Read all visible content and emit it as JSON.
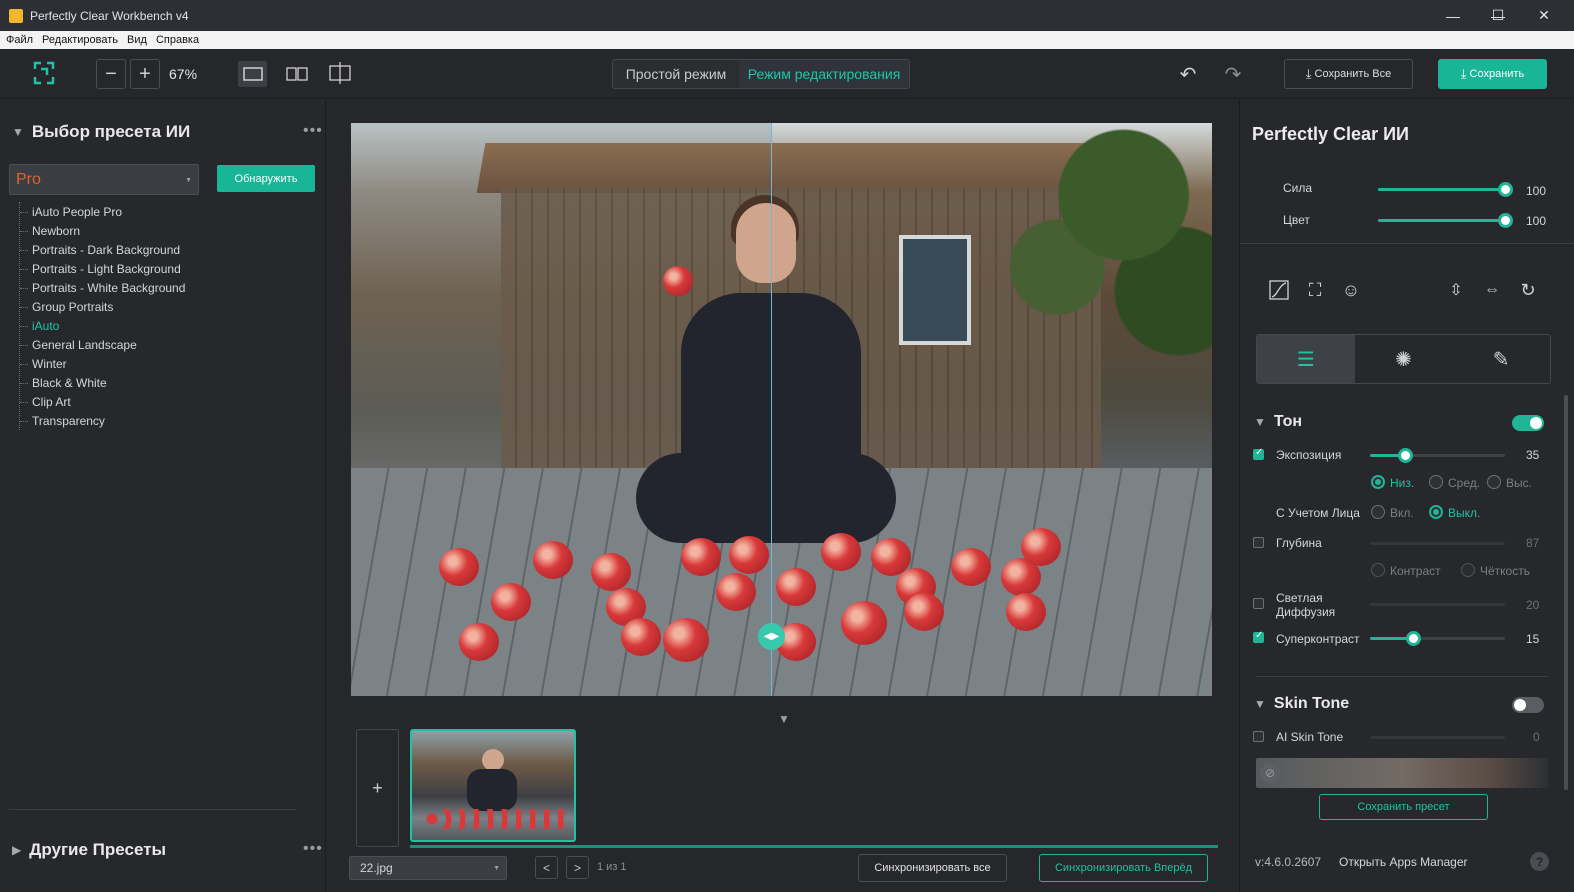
{
  "window": {
    "title": "Perfectly Clear Workbench v4",
    "minimize": "—",
    "maximize": "☐",
    "close": "✕"
  },
  "menu": [
    "Файл",
    "Редактировать",
    "Вид",
    "Справка"
  ],
  "toolbar": {
    "zoom_out": "−",
    "zoom_in": "+",
    "zoom": "67%",
    "mode_simple": "Простой режим",
    "mode_edit": "Режим редактирования",
    "save_all": "Сохранить Все",
    "save": "Сохранить"
  },
  "left": {
    "preset_title": "Выбор пресета ИИ",
    "preset_select": "Pro",
    "detect_button": "Обнаружить",
    "presets": [
      "iAuto People Pro",
      "Newborn",
      "Portraits - Dark Background",
      "Portraits - Light Background",
      "Portraits - White Background",
      "Group Portraits",
      "iAuto",
      "General Landscape",
      "Winter",
      "Black & White",
      "Clip Art",
      "Transparency"
    ],
    "active_preset": "iAuto",
    "other_title": "Другие Пресеты",
    "more": "•••"
  },
  "center": {
    "add_image": "+",
    "file_name": "22.jpg",
    "prev": "<",
    "next": ">",
    "page_info": "1 из 1",
    "sync_all": "Синхронизировать все",
    "sync_forward": "Синхронизировать Вперёд",
    "collapse": "▼"
  },
  "right": {
    "title": "Perfectly Clear ИИ",
    "strength": {
      "label": "Сила",
      "value": 100
    },
    "color": {
      "label": "Цвет",
      "value": 100
    },
    "tone_section": "Тон",
    "exposure": {
      "label": "Экспозиция",
      "value": 35,
      "checked": true
    },
    "exposure_modes": [
      "Низ.",
      "Сред.",
      "Выс."
    ],
    "exposure_mode_selected": "Низ.",
    "face_aware": {
      "label": "С Учетом Лица",
      "options": [
        "Вкл.",
        "Выкл."
      ],
      "selected": "Выкл."
    },
    "depth": {
      "label": "Глубина",
      "value": 87,
      "checked": false
    },
    "depth_modes": [
      "Контраст",
      "Чёткость"
    ],
    "light_diffusion": {
      "label_1": "Светлая",
      "label_2": "Диффузия",
      "value": 20,
      "checked": false
    },
    "supercontrast": {
      "label": "Суперконтраст",
      "value": 15,
      "checked": true
    },
    "skin_section": "Skin Tone",
    "ai_skin_tone": {
      "label": "AI Skin Tone",
      "value": 0,
      "checked": false
    },
    "save_preset": "Сохранить пресет",
    "version": "v:4.6.0.2607",
    "apps_manager": "Открыть Apps Manager",
    "help": "?"
  },
  "colors": {
    "accent": "#1fb596",
    "accent_text": "#20c6a8",
    "preset_select_text": "#e3622f",
    "background": "#26282c"
  }
}
